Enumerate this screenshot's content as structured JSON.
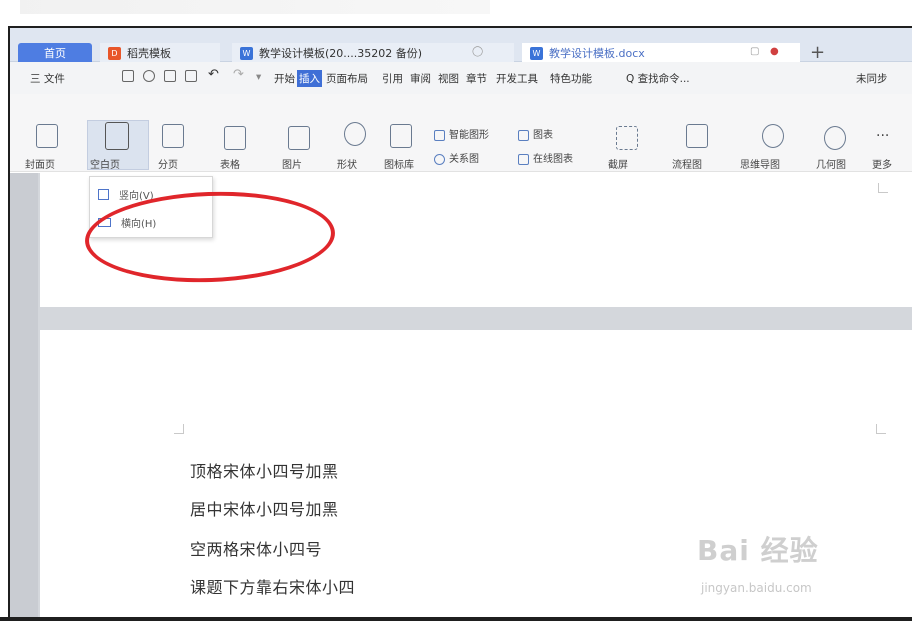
{
  "tabs": {
    "home": "首页",
    "template": "稻壳模板",
    "doc1": "教学设计模板(20....35202 备份)",
    "doc2": "教学设计模板.docx"
  },
  "menu": {
    "file": "三 文件",
    "items": [
      "开始",
      "插入",
      "页面布局",
      "引用",
      "审阅",
      "视图",
      "章节",
      "开发工具",
      "特色功能"
    ],
    "active": "插入",
    "search": "Q 查找命令...",
    "sync": "未同步"
  },
  "ribbon": {
    "cover": "封面页",
    "blank_page": "空白页",
    "page_break": "分页",
    "table": "表格",
    "picture": "图片",
    "shape": "形状",
    "icon_lib": "图标库",
    "smart_art": "智能图形",
    "chart": "图表",
    "relation": "关系图",
    "online_chart": "在线图表",
    "screenshot": "截屏",
    "flowchart": "流程图",
    "mindmap": "思维导图",
    "geometry": "几何图",
    "more": "更多"
  },
  "dropdown": {
    "portrait": "竖向(V)",
    "landscape": "横向(H)"
  },
  "document": {
    "lines": [
      "顶格宋体小四号加黑",
      "居中宋体小四号加黑",
      "空两格宋体小四号",
      "课题下方靠右宋体小四"
    ]
  },
  "watermark": {
    "brand": "Bai 经验",
    "url": "jingyan.baidu.com"
  },
  "colors": {
    "accent": "#3f6fd6",
    "annotation": "#e0262b"
  }
}
